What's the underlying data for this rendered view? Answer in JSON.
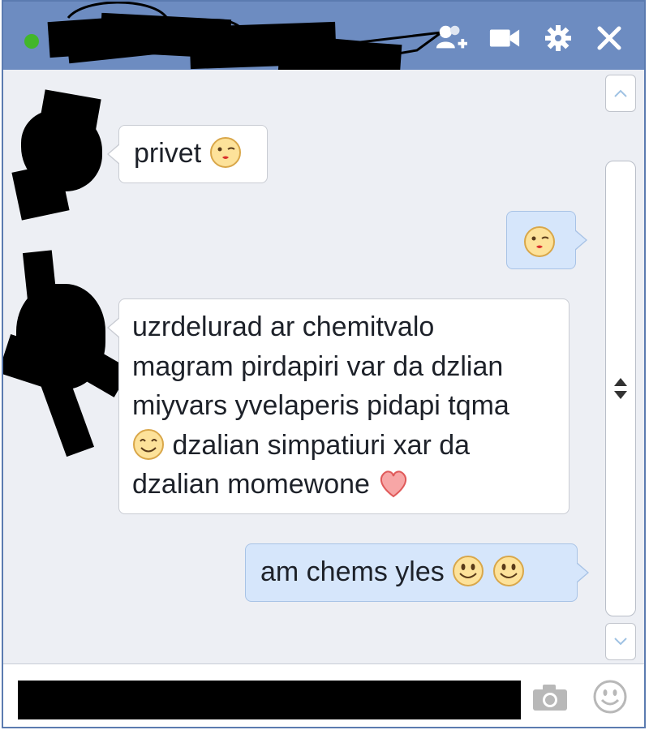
{
  "titlebar": {
    "contact_name": "",
    "status_color": "#42b72a",
    "icons": [
      "add-friend-icon",
      "video-call-icon",
      "settings-icon",
      "close-icon"
    ]
  },
  "messages": [
    {
      "direction": "incoming",
      "text": "privet",
      "emoticons": [
        "kiss-wink-emoticon"
      ]
    },
    {
      "direction": "outgoing",
      "text": "",
      "emoticons": [
        "kiss-wink-emoticon"
      ]
    },
    {
      "direction": "incoming",
      "lines": [
        "uzrdelurad ar chemitvalo",
        "magram pirdapiri var da dzlian",
        "miyvars yvelaperis pidapi tqma",
        "dzalian simpatiuri xar da",
        "dzalian momewone"
      ],
      "emoticons": [
        "smile-emoticon",
        "heart-emoticon"
      ]
    },
    {
      "direction": "outgoing",
      "text": "am chems yles",
      "emoticons": [
        "smile-emoticon",
        "smile-emoticon"
      ]
    }
  ],
  "composer": {
    "value": "",
    "icons": [
      "camera-icon",
      "emoticon-picker-icon"
    ]
  },
  "colors": {
    "titlebar": "#6d8cc1",
    "chat_bg": "#edeff4",
    "outgoing_bubble": "#d6e6fb",
    "incoming_bubble": "#ffffff"
  }
}
